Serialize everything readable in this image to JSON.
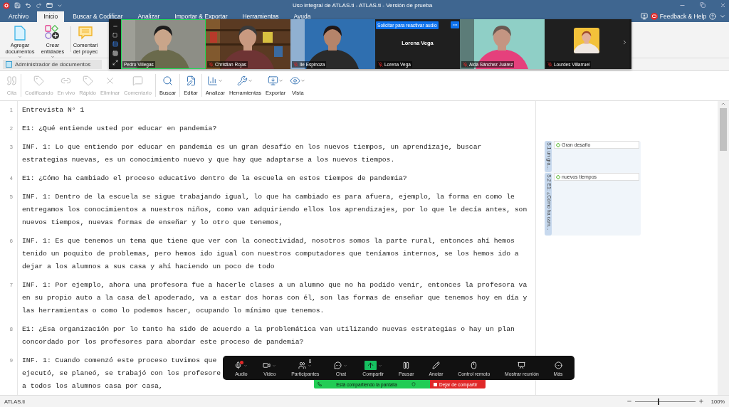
{
  "window": {
    "title": "Uso integral de ATLAS.ti - ATLAS.ti - Versión de prueba"
  },
  "menu_tabs": [
    {
      "label": "Archivo",
      "selected": false
    },
    {
      "label": "Inicio",
      "selected": true
    },
    {
      "label": "Buscar & Codificar",
      "selected": false
    },
    {
      "label": "Analizar",
      "selected": false
    },
    {
      "label": "Importar & Exportar",
      "selected": false
    },
    {
      "label": "Herramientas",
      "selected": false
    },
    {
      "label": "Ayuda",
      "selected": false
    }
  ],
  "feedback": {
    "label": "Feedback & Help"
  },
  "ribbon": [
    {
      "label": "Agregar documentos",
      "has_menu": true
    },
    {
      "label": "Crear entidades",
      "has_menu": true
    },
    {
      "label": "Comentari del proyec",
      "has_menu": false
    }
  ],
  "document_tab": {
    "label": "Administrador de documentos"
  },
  "toolbar": [
    {
      "label": "Cita",
      "disabled": true,
      "has_menu": false
    },
    {
      "label": "Codificando",
      "disabled": true,
      "has_menu": false
    },
    {
      "label": "En vivo",
      "disabled": true,
      "has_menu": false
    },
    {
      "label": "Rápido",
      "disabled": true,
      "has_menu": false
    },
    {
      "label": "Eliminar",
      "disabled": true,
      "has_menu": false
    },
    {
      "label": "Comentario",
      "disabled": true,
      "has_menu": false
    },
    {
      "label": "Buscar",
      "disabled": false,
      "has_menu": false
    },
    {
      "label": "Editar",
      "disabled": false,
      "has_menu": false
    },
    {
      "label": "Analizar",
      "disabled": false,
      "has_menu": true
    },
    {
      "label": "Herramientas",
      "disabled": false,
      "has_menu": true
    },
    {
      "label": "Exportar",
      "disabled": false,
      "has_menu": true
    },
    {
      "label": "Vista",
      "disabled": false,
      "has_menu": true
    }
  ],
  "document": {
    "paragraphs": [
      {
        "number": "1",
        "lines": [
          "Entrevista N° 1"
        ]
      },
      {
        "number": "2",
        "lines": [
          "E1: ¿Qué entiende usted por educar en pandemia?"
        ]
      },
      {
        "number": "3",
        "lines": [
          "INF. 1: Lo que entiendo por educar en pandemia es un gran desafío en los nuevos tiempos, un aprendizaje, buscar",
          "estrategias nuevas, es un conocimiento nuevo y que hay que adaptarse a los nuevos tiempos."
        ]
      },
      {
        "number": "4",
        "lines": [
          "E1: ¿Cómo ha cambiado el proceso educativo dentro de la escuela en estos tiempos de pandemia?"
        ]
      },
      {
        "number": "5",
        "lines": [
          "INF. 1: Dentro de la escuela se sigue trabajando igual, lo que ha cambiado es para afuera, ejemplo, la forma en como le",
          "entregamos los conocimientos a nuestros niños, como van adquiriendo ellos los aprendizajes, por lo que le decía antes, son",
          "nuevos tiempos, nuevas formas de enseñar y lo otro que tenemos,"
        ]
      },
      {
        "number": "6",
        "lines": [
          "INF. 1: Es que tenemos un tema que tiene que ver con la conectividad, nosotros somos la parte rural, entonces ahí hemos",
          "tenido un poquito de problemas, pero hemos ido igual con nuestros computadores que teníamos internos, se los hemos ido a",
          "dejar a los alumnos a sus casa y ahí haciendo un poco de todo"
        ]
      },
      {
        "number": "7",
        "lines": [
          "INF. 1: Por ejemplo, ahora una profesora fue a hacerle clases a un alumno que no ha podido venir, entonces la profesora va",
          "en su propio auto a la casa del apoderado, va a estar dos horas con él, son las formas de enseñar que tenemos hoy en día y",
          "las herramientas o como lo podemos hacer, ocupando lo mínimo que tenemos."
        ]
      },
      {
        "number": "8",
        "lines": [
          "E1: ¿Esa organización por lo tanto ha sido de acuerdo a la problemática van utilizando nuevas estrategias o hay un plan",
          "concordado por los profesores para abordar este proceso de pandemia?"
        ]
      },
      {
        "number": "9",
        "lines": [
          "INF. 1: Cuando comenzó este proceso tuvimos que",
          "ejecutó, se planeó, se trabajó con los profesore",
          "a todos los alumnos casa por casa,"
        ]
      }
    ]
  },
  "margin": {
    "quotations": [
      {
        "label": "S:1 un gra...",
        "code": "Gran desafío"
      },
      {
        "label": "S:2 E1: ¿Cómo ha cam...",
        "code": "nuevos tiempos"
      }
    ]
  },
  "status_bar": {
    "app": "ATLAS.ti",
    "zoom": {
      "level": 0.38,
      "reading": "100%"
    }
  },
  "meeting": {
    "participants": [
      {
        "name": "Pedro Villegas",
        "kind": "video",
        "selected": true,
        "muted": false
      },
      {
        "name": "Christian Rojas",
        "kind": "video",
        "selected": false,
        "muted": true
      },
      {
        "name": "Ile Espinoza",
        "kind": "video",
        "selected": false,
        "muted": true
      },
      {
        "name": "Lorena Vega",
        "kind": "name_only",
        "selected": false,
        "muted": true,
        "center_label": "Lorena Vega",
        "request_button": "Solicitar para reactivar audio"
      },
      {
        "name": "Aida Sánchez Juárez",
        "kind": "video",
        "selected": false,
        "muted": true
      },
      {
        "name": "Lourdes Villarruel",
        "kind": "avatar",
        "selected": false,
        "muted": true
      }
    ],
    "controls": [
      {
        "label": "Audio",
        "has_menu": true,
        "alert": true
      },
      {
        "label": "Video",
        "has_menu": true
      },
      {
        "label": "Participantes",
        "has_menu": true,
        "count": "8"
      },
      {
        "label": "Chat",
        "has_menu": true
      },
      {
        "label": "Compartir",
        "has_menu": true,
        "active": true
      },
      {
        "label": "Pausar",
        "has_menu": false
      },
      {
        "label": "Anotar",
        "has_menu": false
      },
      {
        "label": "Control remoto",
        "has_menu": false
      },
      {
        "label": "Mostrar reunión",
        "has_menu": false
      },
      {
        "label": "Más",
        "has_menu": false
      }
    ],
    "share_banner": {
      "status": "Está compartiendo la pantalla",
      "stop": "Dejar de compartir"
    }
  }
}
